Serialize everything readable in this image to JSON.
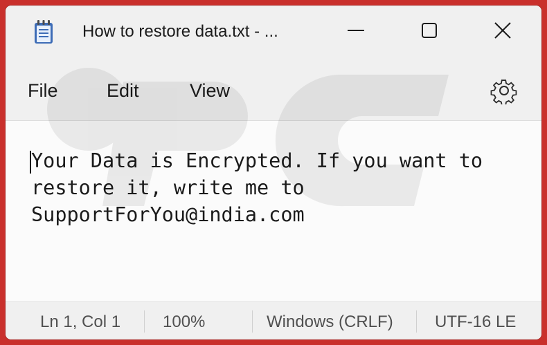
{
  "window": {
    "title": "How to restore data.txt - ...",
    "app_icon": "notepad-icon",
    "controls": {
      "minimize": "minimize-icon",
      "maximize": "maximize-icon",
      "close": "close-icon"
    }
  },
  "menu": {
    "items": [
      {
        "label": "File"
      },
      {
        "label": "Edit"
      },
      {
        "label": "View"
      }
    ],
    "settings_icon": "gear-icon"
  },
  "editor": {
    "lines": [
      "Your Data is Encrypted. If you want to",
      "restore it, write me to",
      "SupportForYou@india.com"
    ]
  },
  "status": {
    "position": "Ln 1, Col 1",
    "zoom": "100%",
    "line_ending": "Windows (CRLF)",
    "encoding": "UTF-16 LE"
  },
  "colors": {
    "background_outer": "#c9302c",
    "window_chrome": "#f0f0f0",
    "editor_bg": "#fbfbfb",
    "notepad_icon_blue": "#3d6cb6"
  }
}
